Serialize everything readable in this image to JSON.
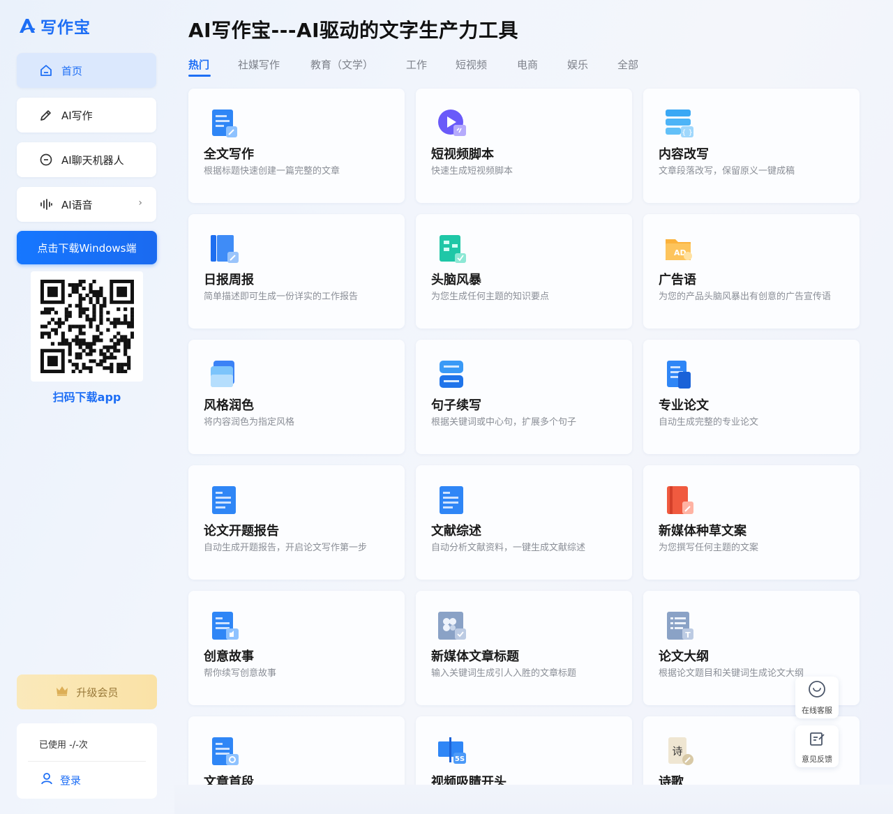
{
  "brand": {
    "logo_text": "写作宝"
  },
  "sidebar": {
    "items": [
      {
        "label": "首页",
        "icon": "home-icon"
      },
      {
        "label": "AI写作",
        "icon": "pencil-icon"
      },
      {
        "label": "AI聊天机器人",
        "icon": "chat-bubble-icon"
      },
      {
        "label": "AI语音",
        "icon": "sound-wave-icon"
      }
    ],
    "download_label": "点击下载Windows端",
    "qr_caption": "扫码下载app",
    "upgrade_label": "升级会员",
    "usage_text": "已使用 -/-次",
    "login_label": "登录"
  },
  "main": {
    "title": "AI写作宝---AI驱动的文字生产力工具",
    "tabs": [
      "热门",
      "社媒写作",
      "教育（文学）",
      "工作",
      "短视频",
      "电商",
      "娱乐",
      "全部"
    ],
    "cards": [
      {
        "title": "全文写作",
        "desc": "根据标题快速创建一篇完整的文章",
        "icon": "document-edit-icon"
      },
      {
        "title": "短视频脚本",
        "desc": "快速生成短视频脚本",
        "icon": "video-play-icon"
      },
      {
        "title": "内容改写",
        "desc": "文章段落改写，保留原义一键成稿",
        "icon": "rewrite-doc-icon"
      },
      {
        "title": "日报周报",
        "desc": "简单描述即可生成一份详实的工作报告",
        "icon": "report-book-icon"
      },
      {
        "title": "头脑风暴",
        "desc": "为您生成任何主题的知识要点",
        "icon": "mindmap-icon"
      },
      {
        "title": "广告语",
        "desc": "为您的产品头脑风暴出有创意的广告宣传语",
        "icon": "ad-folder-icon"
      },
      {
        "title": "风格润色",
        "desc": "将内容润色为指定风格",
        "icon": "folder-style-icon"
      },
      {
        "title": "句子续写",
        "desc": "根据关键词或中心句，扩展多个句子",
        "icon": "sentence-blocks-icon"
      },
      {
        "title": "专业论文",
        "desc": "自动生成完整的专业论文",
        "icon": "paper-doc-icon"
      },
      {
        "title": "论文开题报告",
        "desc": "自动生成开题报告，开启论文写作第一步",
        "icon": "proposal-doc-icon"
      },
      {
        "title": "文献综述",
        "desc": "自动分析文献资料，一键生成文献综述",
        "icon": "literature-doc-icon"
      },
      {
        "title": "新媒体种草文案",
        "desc": "为您撰写任何主题的文案",
        "icon": "red-book-icon"
      },
      {
        "title": "创意故事",
        "desc": "帮你续写创意故事",
        "icon": "story-doc-icon"
      },
      {
        "title": "新媒体文章标题",
        "desc": "输入关键词生成引人入胜的文章标题",
        "icon": "clover-title-icon"
      },
      {
        "title": "论文大纲",
        "desc": "根据论文题目和关键词生成论文大纲",
        "icon": "outline-doc-icon"
      },
      {
        "title": "文章首段",
        "desc": "",
        "icon": "first-paragraph-icon"
      },
      {
        "title": "视频吸睛开头",
        "desc": "",
        "icon": "video-5s-icon"
      },
      {
        "title": "诗歌",
        "desc": "",
        "icon": "poem-scroll-icon"
      }
    ]
  },
  "floating": {
    "service_label": "在线客服",
    "feedback_label": "意见反馈"
  },
  "colors": {
    "accent": "#1d6ef5",
    "upgrade": "#fcdf98"
  }
}
